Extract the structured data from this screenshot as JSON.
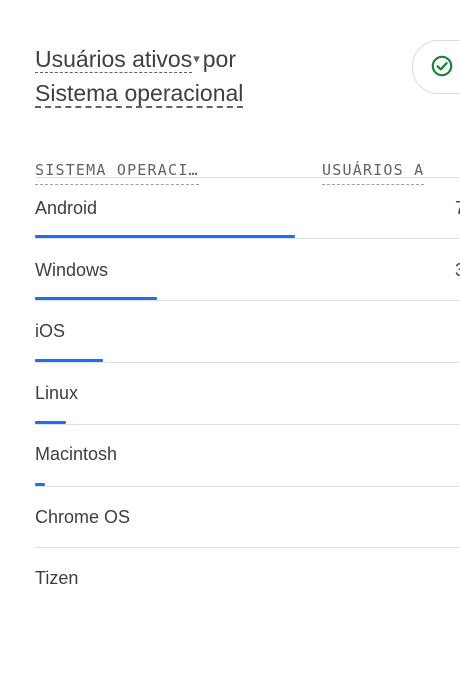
{
  "card": {
    "title_metric": "Usuários ativos",
    "title_caret": "▾",
    "title_connector": "por",
    "title_dimension": "Sistema operacional",
    "status_icon": "check-circle-icon",
    "accent_color": "#1a73e8",
    "status_color": "#188038"
  },
  "table": {
    "headers": {
      "os": "SISTEMA OPERACI…",
      "users": "USUÁRIOS A"
    },
    "rows": [
      {
        "os": "Android",
        "value_fragment": "7",
        "share": 1.0
      },
      {
        "os": "Windows",
        "value_fragment": "3",
        "share": 0.47
      },
      {
        "os": "iOS",
        "value_fragment": "",
        "share": 0.26
      },
      {
        "os": "Linux",
        "value_fragment": "",
        "share": 0.12
      },
      {
        "os": "Macintosh",
        "value_fragment": "",
        "share": 0.04
      },
      {
        "os": "Chrome OS",
        "value_fragment": "",
        "share": 0.0
      },
      {
        "os": "Tizen",
        "value_fragment": "",
        "share": 0.0
      }
    ]
  }
}
